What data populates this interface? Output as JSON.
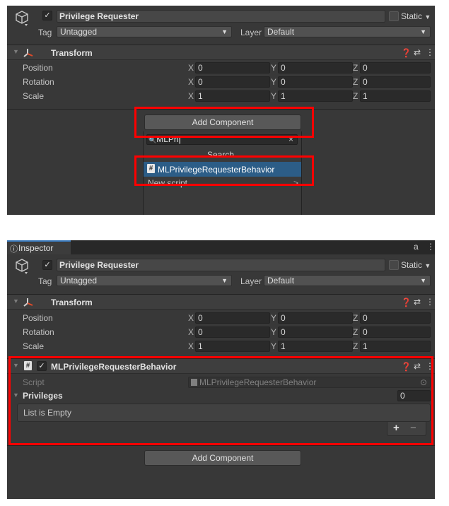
{
  "colors": {
    "panel_bg": "#383838",
    "highlight": "#ff0000",
    "selection": "#2c5d87"
  },
  "top": {
    "object": {
      "name": "Privilege Requester",
      "active": true,
      "static_label": "Static",
      "static_arrow": "▼",
      "tag_label": "Tag",
      "tag_value": "Untagged",
      "layer_label": "Layer",
      "layer_value": "Default",
      "icon": "cube-icon"
    },
    "transform": {
      "title": "Transform",
      "rows": [
        {
          "label": "Position",
          "x": "0",
          "y": "0",
          "z": "0"
        },
        {
          "label": "Rotation",
          "x": "0",
          "y": "0",
          "z": "0"
        },
        {
          "label": "Scale",
          "x": "1",
          "y": "1",
          "z": "1"
        }
      ],
      "axis_x": "X",
      "axis_y": "Y",
      "axis_z": "Z"
    },
    "add_component_label": "Add Component",
    "popup": {
      "search_value": "MLPri",
      "clear_glyph": "×",
      "section_label": "Search",
      "result_label": "MLPrivilegeRequesterBehavior",
      "new_script_label": "New script",
      "new_script_arrow": ">"
    }
  },
  "bottom": {
    "tab_label": "Inspector",
    "lock_glyph": "a",
    "menu_glyph": "⋮",
    "object": {
      "name": "Privilege Requester",
      "static_label": "Static",
      "static_arrow": "▼",
      "tag_label": "Tag",
      "tag_value": "Untagged",
      "layer_label": "Layer",
      "layer_value": "Default"
    },
    "transform": {
      "title": "Transform",
      "rows": [
        {
          "label": "Position",
          "x": "0",
          "y": "0",
          "z": "0"
        },
        {
          "label": "Rotation",
          "x": "0",
          "y": "0",
          "z": "0"
        },
        {
          "label": "Scale",
          "x": "1",
          "y": "1",
          "z": "1"
        }
      ],
      "axis_x": "X",
      "axis_y": "Y",
      "axis_z": "Z"
    },
    "component": {
      "title": "MLPrivilegeRequesterBehavior",
      "script_label": "Script",
      "script_value": "MLPrivilegeRequesterBehavior",
      "privileges_label": "Privileges",
      "privileges_count": "0",
      "list_empty": "List is Empty",
      "add_glyph": "+",
      "remove_glyph": "−"
    },
    "add_component_label": "Add Component"
  }
}
